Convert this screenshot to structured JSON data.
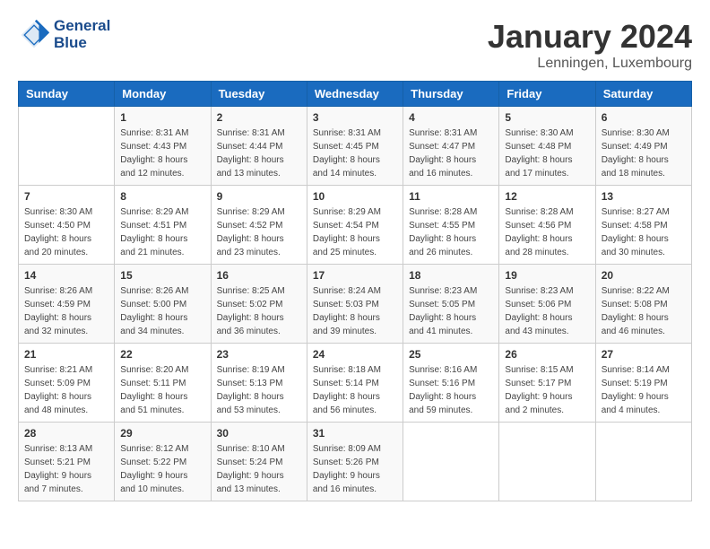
{
  "header": {
    "logo_line1": "General",
    "logo_line2": "Blue",
    "month": "January 2024",
    "location": "Lenningen, Luxembourg"
  },
  "weekdays": [
    "Sunday",
    "Monday",
    "Tuesday",
    "Wednesday",
    "Thursday",
    "Friday",
    "Saturday"
  ],
  "weeks": [
    [
      {
        "day": "",
        "info": ""
      },
      {
        "day": "1",
        "info": "Sunrise: 8:31 AM\nSunset: 4:43 PM\nDaylight: 8 hours\nand 12 minutes."
      },
      {
        "day": "2",
        "info": "Sunrise: 8:31 AM\nSunset: 4:44 PM\nDaylight: 8 hours\nand 13 minutes."
      },
      {
        "day": "3",
        "info": "Sunrise: 8:31 AM\nSunset: 4:45 PM\nDaylight: 8 hours\nand 14 minutes."
      },
      {
        "day": "4",
        "info": "Sunrise: 8:31 AM\nSunset: 4:47 PM\nDaylight: 8 hours\nand 16 minutes."
      },
      {
        "day": "5",
        "info": "Sunrise: 8:30 AM\nSunset: 4:48 PM\nDaylight: 8 hours\nand 17 minutes."
      },
      {
        "day": "6",
        "info": "Sunrise: 8:30 AM\nSunset: 4:49 PM\nDaylight: 8 hours\nand 18 minutes."
      }
    ],
    [
      {
        "day": "7",
        "info": "Sunrise: 8:30 AM\nSunset: 4:50 PM\nDaylight: 8 hours\nand 20 minutes."
      },
      {
        "day": "8",
        "info": "Sunrise: 8:29 AM\nSunset: 4:51 PM\nDaylight: 8 hours\nand 21 minutes."
      },
      {
        "day": "9",
        "info": "Sunrise: 8:29 AM\nSunset: 4:52 PM\nDaylight: 8 hours\nand 23 minutes."
      },
      {
        "day": "10",
        "info": "Sunrise: 8:29 AM\nSunset: 4:54 PM\nDaylight: 8 hours\nand 25 minutes."
      },
      {
        "day": "11",
        "info": "Sunrise: 8:28 AM\nSunset: 4:55 PM\nDaylight: 8 hours\nand 26 minutes."
      },
      {
        "day": "12",
        "info": "Sunrise: 8:28 AM\nSunset: 4:56 PM\nDaylight: 8 hours\nand 28 minutes."
      },
      {
        "day": "13",
        "info": "Sunrise: 8:27 AM\nSunset: 4:58 PM\nDaylight: 8 hours\nand 30 minutes."
      }
    ],
    [
      {
        "day": "14",
        "info": "Sunrise: 8:26 AM\nSunset: 4:59 PM\nDaylight: 8 hours\nand 32 minutes."
      },
      {
        "day": "15",
        "info": "Sunrise: 8:26 AM\nSunset: 5:00 PM\nDaylight: 8 hours\nand 34 minutes."
      },
      {
        "day": "16",
        "info": "Sunrise: 8:25 AM\nSunset: 5:02 PM\nDaylight: 8 hours\nand 36 minutes."
      },
      {
        "day": "17",
        "info": "Sunrise: 8:24 AM\nSunset: 5:03 PM\nDaylight: 8 hours\nand 39 minutes."
      },
      {
        "day": "18",
        "info": "Sunrise: 8:23 AM\nSunset: 5:05 PM\nDaylight: 8 hours\nand 41 minutes."
      },
      {
        "day": "19",
        "info": "Sunrise: 8:23 AM\nSunset: 5:06 PM\nDaylight: 8 hours\nand 43 minutes."
      },
      {
        "day": "20",
        "info": "Sunrise: 8:22 AM\nSunset: 5:08 PM\nDaylight: 8 hours\nand 46 minutes."
      }
    ],
    [
      {
        "day": "21",
        "info": "Sunrise: 8:21 AM\nSunset: 5:09 PM\nDaylight: 8 hours\nand 48 minutes."
      },
      {
        "day": "22",
        "info": "Sunrise: 8:20 AM\nSunset: 5:11 PM\nDaylight: 8 hours\nand 51 minutes."
      },
      {
        "day": "23",
        "info": "Sunrise: 8:19 AM\nSunset: 5:13 PM\nDaylight: 8 hours\nand 53 minutes."
      },
      {
        "day": "24",
        "info": "Sunrise: 8:18 AM\nSunset: 5:14 PM\nDaylight: 8 hours\nand 56 minutes."
      },
      {
        "day": "25",
        "info": "Sunrise: 8:16 AM\nSunset: 5:16 PM\nDaylight: 8 hours\nand 59 minutes."
      },
      {
        "day": "26",
        "info": "Sunrise: 8:15 AM\nSunset: 5:17 PM\nDaylight: 9 hours\nand 2 minutes."
      },
      {
        "day": "27",
        "info": "Sunrise: 8:14 AM\nSunset: 5:19 PM\nDaylight: 9 hours\nand 4 minutes."
      }
    ],
    [
      {
        "day": "28",
        "info": "Sunrise: 8:13 AM\nSunset: 5:21 PM\nDaylight: 9 hours\nand 7 minutes."
      },
      {
        "day": "29",
        "info": "Sunrise: 8:12 AM\nSunset: 5:22 PM\nDaylight: 9 hours\nand 10 minutes."
      },
      {
        "day": "30",
        "info": "Sunrise: 8:10 AM\nSunset: 5:24 PM\nDaylight: 9 hours\nand 13 minutes."
      },
      {
        "day": "31",
        "info": "Sunrise: 8:09 AM\nSunset: 5:26 PM\nDaylight: 9 hours\nand 16 minutes."
      },
      {
        "day": "",
        "info": ""
      },
      {
        "day": "",
        "info": ""
      },
      {
        "day": "",
        "info": ""
      }
    ]
  ]
}
